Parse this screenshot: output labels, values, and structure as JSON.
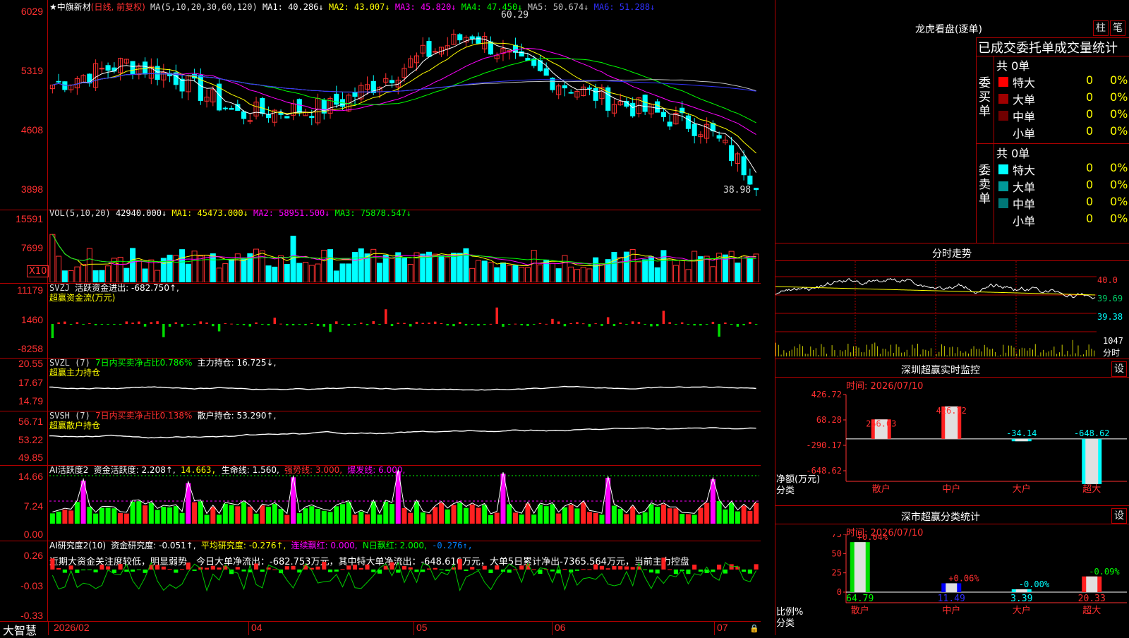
{
  "left_chart": {
    "price_panel": {
      "title": "★中旗新材",
      "period_label": "(日线, 前复权)",
      "ma_label": "MA(5,10,20,30,60,120)",
      "ma_values": [
        {
          "label": "MA1: 40.286↓",
          "color": "#ffffff"
        },
        {
          "label": "MA2: 43.007↓",
          "color": "#ffff00"
        },
        {
          "label": "MA3: 45.820↓",
          "color": "#ff00ff"
        },
        {
          "label": "MA4: 47.450↓",
          "color": "#00ff00"
        },
        {
          "label": "MA5: 50.674↓",
          "color": "#c0c0c0"
        },
        {
          "label": "MA6: 51.288↓",
          "color": "#0000ff"
        }
      ],
      "y_ticks": [
        "6029",
        "5319",
        "4608",
        "3898"
      ],
      "high_label": "60.29",
      "low_label": "38.98"
    },
    "vol_panel": {
      "title": "VOL(5,10,20)",
      "values": [
        {
          "label": "42940.000↓",
          "color": "#ffffff"
        },
        {
          "label": "MA1: 45473.000↓",
          "color": "#ffff00"
        },
        {
          "label": "MA2: 58951.500↓",
          "color": "#ff00ff"
        },
        {
          "label": "MA3: 75878.547↓",
          "color": "#00ff00"
        }
      ],
      "y_ticks": [
        "15591",
        "7699"
      ],
      "unit": "X10"
    },
    "svzj_panel": {
      "title": "SVZJ",
      "desc": "活跃资金进出: -682.750↑,",
      "subtitle": "超赢资金流(万元)",
      "y_ticks": [
        "11179",
        "1460",
        "-8258"
      ]
    },
    "svzl_panel": {
      "title": "SVZL (7)",
      "ratio": "7日内买卖净占比0.786%",
      "holding": "主力持仓: 16.725↓,",
      "subtitle": "超赢主力持仓",
      "y_ticks": [
        "20.55",
        "17.67",
        "14.79"
      ]
    },
    "svsh_panel": {
      "title": "SVSH (7)",
      "ratio": "7日内买卖净占比0.138%",
      "holding": "散户持仓: 53.290↑,",
      "subtitle": "超赢散户持仓",
      "y_ticks": [
        "56.71",
        "53.22",
        "49.85"
      ]
    },
    "ai_active_panel": {
      "title": "AI活跃度2",
      "values": [
        {
          "label": "资金活跃度: 2.208↑,",
          "color": "#ffffff"
        },
        {
          "label": "14.663,",
          "color": "#ffff00"
        },
        {
          "label": "生命线: 1.560,",
          "color": "#ffffff"
        },
        {
          "label": "强势线: 3.000,",
          "color": "#ff3030"
        },
        {
          "label": "爆发线: 6.000,",
          "color": "#ff00ff"
        }
      ],
      "y_ticks": [
        "14.66",
        "7.24",
        "0.00"
      ]
    },
    "ai_research_panel": {
      "title": "AI研究度2(10)",
      "values": [
        {
          "label": "资金研究度: -0.051↑,",
          "color": "#ffffff"
        },
        {
          "label": "平均研究度: -0.276↑,",
          "color": "#ffff00"
        },
        {
          "label": "连续飘红: 0.000,",
          "color": "#ff00ff"
        },
        {
          "label": "N日飘红: 2.000,",
          "color": "#00ff00"
        },
        {
          "label": "-0.276↑,",
          "color": "#0080ff"
        }
      ],
      "comment": "近期大资金关注度较低，明显弱势，今日大单净流出：-682.753万元，其中特大单净流出：-648.616万元，大单5日累计净出-7365.564万元，当前主力控盘",
      "y_ticks": [
        "0.26",
        "-0.03",
        "-0.33"
      ]
    },
    "bottom_bar": {
      "brand": "大智慧",
      "dates": [
        "2026/02",
        "04",
        "05",
        "06",
        "07"
      ]
    }
  },
  "right_panel": {
    "dragon_tiger": {
      "title": "龙虎看盘(逐单)",
      "btn_column": "柱",
      "btn_brush": "笔",
      "stat_title": "已成交委托单成交量统计",
      "buy": {
        "side_label": "委买单",
        "total": "共 0单",
        "rows": [
          {
            "label": "特大",
            "count": "0",
            "pct": "0%",
            "color": "#ff0000"
          },
          {
            "label": "大单",
            "count": "0",
            "pct": "0%",
            "color": "#a00000"
          },
          {
            "label": "中单",
            "count": "0",
            "pct": "0%",
            "color": "#700000"
          },
          {
            "label": "小单",
            "count": "0",
            "pct": "0%",
            "color": "#000000"
          }
        ]
      },
      "sell": {
        "side_label": "委卖单",
        "total": "共 0单",
        "rows": [
          {
            "label": "特大",
            "count": "0",
            "pct": "0%",
            "color": "#00ffff"
          },
          {
            "label": "大单",
            "count": "0",
            "pct": "0%",
            "color": "#009999"
          },
          {
            "label": "中单",
            "count": "0",
            "pct": "0%",
            "color": "#007777"
          },
          {
            "label": "小单",
            "count": "0",
            "pct": "0%",
            "color": "#000000"
          }
        ]
      }
    },
    "intraday": {
      "title": "分时走势",
      "prices": [
        "40.0",
        "39.69",
        "39.38"
      ],
      "vol_label": "1047",
      "vol_unit": "分时"
    },
    "sz_monitor": {
      "title": "深圳超赢实时监控",
      "set_btn": "设",
      "time": "时间: 2026/07/10",
      "y_ticks": [
        "426.72",
        "68.28",
        "-290.17",
        "-648.62"
      ],
      "axis_label_1": "净额(万元)",
      "axis_label_2": "分类",
      "chart_data": {
        "type": "bar",
        "categories": [
          "散户",
          "中户",
          "大户",
          "超大"
        ],
        "values": [
          256.03,
          426.72,
          -34.14,
          -648.62
        ],
        "value_labels": [
          "256.03",
          "426.72",
          "-34.14",
          "-648.62"
        ],
        "ylim": [
          -648.62,
          426.72
        ]
      }
    },
    "sz_class": {
      "title": "深市超赢分类统计",
      "set_btn": "设",
      "time": "时间: 2026/07/10",
      "y_ticks": [
        "75",
        "50",
        "25",
        "0"
      ],
      "axis_label_1": "比例%",
      "axis_label_2": "分类",
      "chart_data": {
        "type": "bar",
        "categories": [
          "散户",
          "中户",
          "大户",
          "超大"
        ],
        "values": [
          64.79,
          11.49,
          3.39,
          20.33
        ],
        "value_labels": [
          "64.79",
          "11.49",
          "3.39",
          "20.33"
        ],
        "change_labels": [
          "+0.04%",
          "+0.06%",
          "-0.00%",
          "-0.09%"
        ],
        "ylim": [
          0,
          75
        ]
      }
    }
  }
}
